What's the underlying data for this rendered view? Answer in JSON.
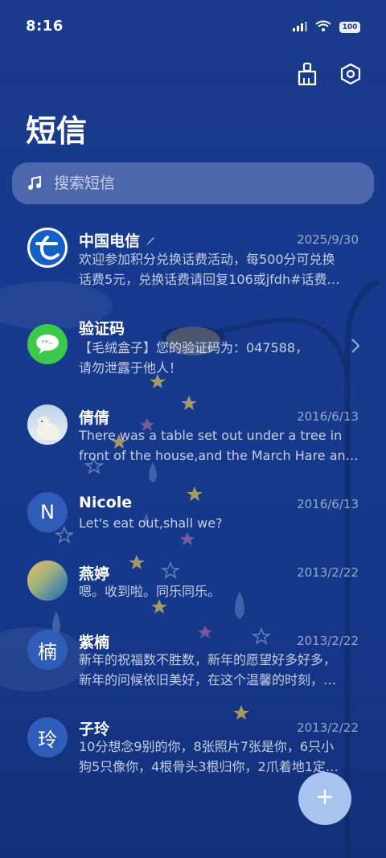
{
  "status_bar": {
    "time": "8:16",
    "battery": "100"
  },
  "header": {
    "title": "短信",
    "clean_icon": "broom-icon",
    "settings_icon": "settings-hexagon-icon"
  },
  "search": {
    "placeholder": "搜索短信",
    "icon": "music-note-icon"
  },
  "conversations": [
    {
      "name": "中国电信",
      "date": "2025/9/30",
      "line1": "欢迎参加积分兑换话费活动，每500分可兑换",
      "line2": "话费5元，兑换话费请回复106或jfdh#话费…",
      "avatar": "china-telecom-logo",
      "draft_icon": "pencil-icon"
    },
    {
      "name": "验证码",
      "date": "",
      "line1": "【毛绒盒子】您的验证码为：047588，",
      "line2": "请勿泄露于他人！",
      "avatar": "message-bubble-icon",
      "chevron_icon": "chevron-right-icon"
    },
    {
      "name": "倩倩",
      "date": "2016/6/13",
      "line1": "There was a table set out under a tree in",
      "line2": "front of the house,and the March Hare an…",
      "avatar": "polar-bear-photo"
    },
    {
      "name": "Nicole",
      "date": "2016/6/13",
      "line1": "Let's eat out,shall we?",
      "line2": "",
      "avatar_letter": "N"
    },
    {
      "name": "燕婷",
      "date": "2013/2/22",
      "line1": "嗯。收到啦。同乐同乐。",
      "line2": "",
      "avatar": "landscape-photo"
    },
    {
      "name": "紫楠",
      "date": "2013/2/22",
      "line1": "新年的祝福数不胜数，新年的愿望好多好多，",
      "line2": "新年的问候依旧美好，在这个温馨的时刻，…",
      "avatar_letter": "楠"
    },
    {
      "name": "子玲",
      "date": "2013/2/22",
      "line1": "10分想念9别的你，8张照片7张是你，6只小",
      "line2": "狗5只像你，4根骨头3根归你，2爪着地1定…",
      "avatar_letter": "玲"
    }
  ],
  "fab": {
    "icon": "plus-icon"
  },
  "colors": {
    "background": "#1a3a8c",
    "fab": "#a9c3ef",
    "avatar_letter_bg": "#2e5cb8",
    "sms_green": "#3cc84a"
  }
}
